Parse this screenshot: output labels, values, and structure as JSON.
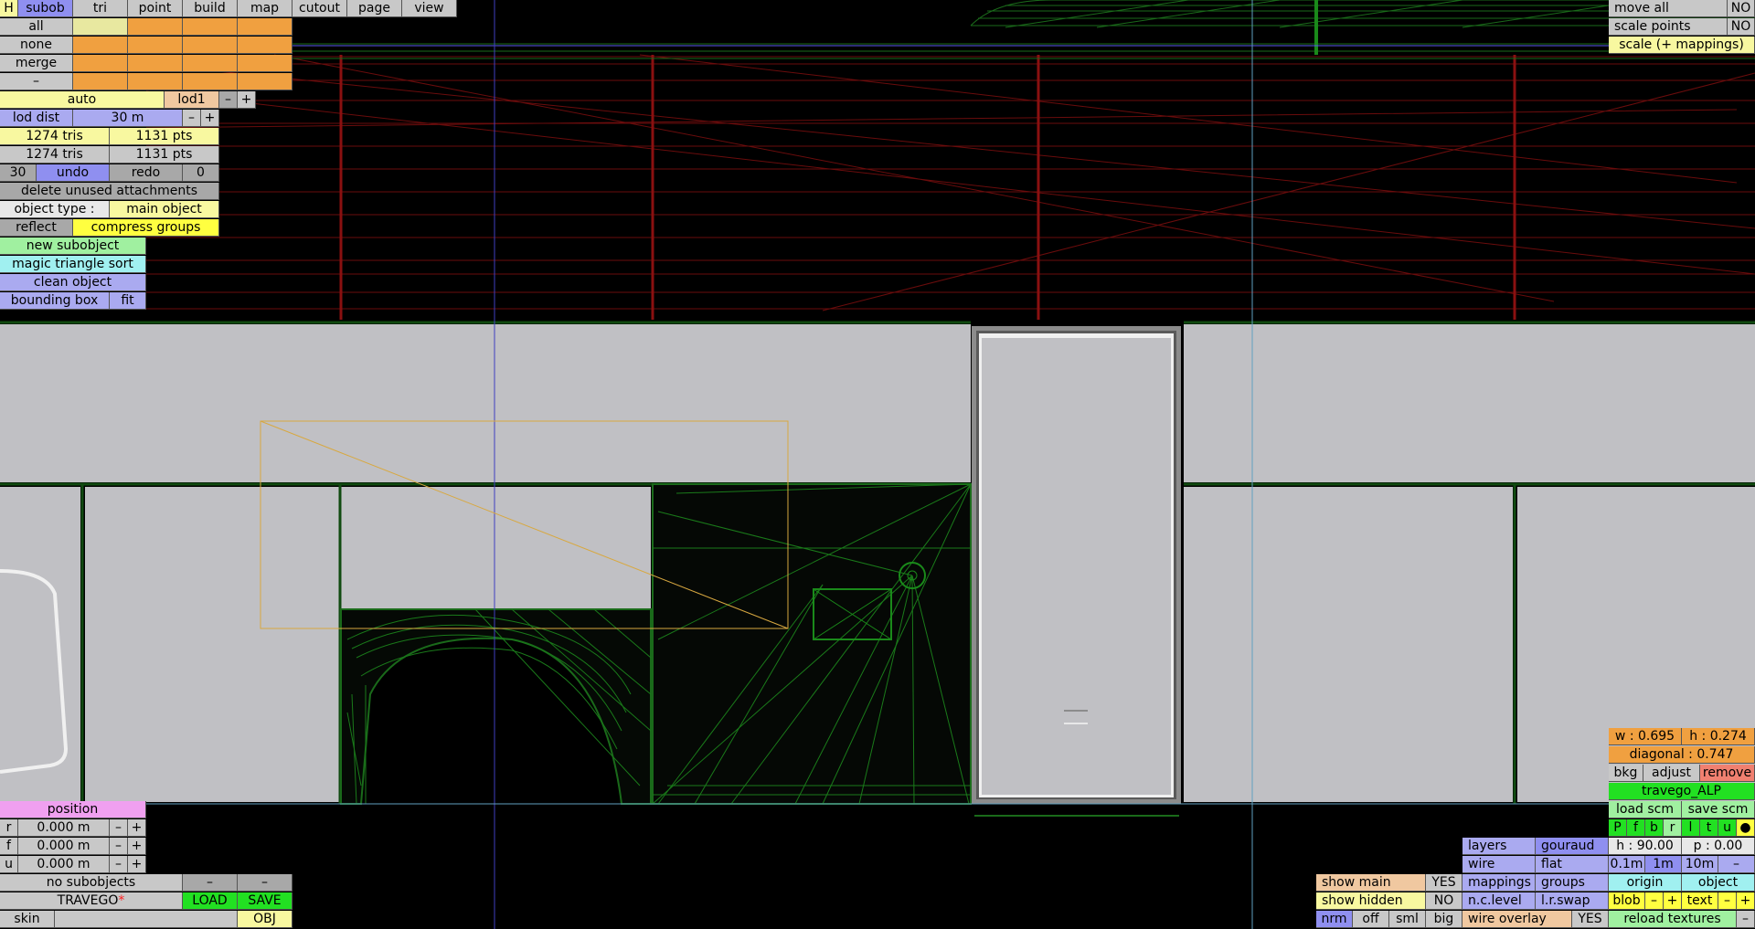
{
  "top_tabs": [
    "H",
    "subob",
    "tri",
    "point",
    "build",
    "map",
    "cutout",
    "page",
    "view"
  ],
  "select_rows": [
    "all",
    "none",
    "merge",
    "–"
  ],
  "lod": {
    "auto": "auto",
    "name": "lod1",
    "minus": "–",
    "plus": "+"
  },
  "lod_dist": {
    "label": "lod dist",
    "value": "30 m",
    "minus": "–",
    "plus": "+"
  },
  "stats": [
    {
      "tris": "1274 tris",
      "pts": "1131 pts"
    },
    {
      "tris": "1274 tris",
      "pts": "1131 pts"
    }
  ],
  "history": {
    "count": "30",
    "undo": "undo",
    "redo": "redo",
    "redo_count": "0"
  },
  "delete_unused": "delete unused attachments",
  "object_type": {
    "label": "object type :",
    "value": "main object"
  },
  "reflect": "reflect",
  "compress_groups": "compress groups",
  "new_subobject": "new subobject",
  "magic_sort": "magic triangle sort",
  "clean_object": "clean object",
  "bounding_box": "bounding box",
  "fit": "fit",
  "position": {
    "title": "position",
    "rows": [
      {
        "axis": "r",
        "value": "0.000 m"
      },
      {
        "axis": "f",
        "value": "0.000 m"
      },
      {
        "axis": "u",
        "value": "0.000 m"
      }
    ],
    "minus": "–",
    "plus": "+"
  },
  "bottom_left": {
    "no_subobjects": "no subobjects",
    "dash": "–",
    "file_name": "TRAVEGO",
    "modified_mark": "*",
    "load": "LOAD",
    "save": "SAVE",
    "skin": "skin",
    "obj": "OBJ"
  },
  "top_right": {
    "move_all": "move all",
    "move_all_value": "NO",
    "scale_points": "scale points",
    "scale_points_value": "NO",
    "scale_mappings": "scale (+ mappings)"
  },
  "image_panel": {
    "w": "w : 0.695",
    "h": "h : 0.274",
    "diagonal": "diagonal : 0.747",
    "bkg": "bkg",
    "adjust": "adjust",
    "remove": "remove",
    "image_name": "travego_ALP",
    "load_scm": "load scm",
    "save_scm": "save scm",
    "views": [
      "P",
      "f",
      "b",
      "r",
      "l",
      "t",
      "u",
      "●"
    ],
    "h_angle": "h : 90.00",
    "p_angle": "p : 0.00",
    "steps": [
      "0.1m",
      "1m",
      "10m",
      "–"
    ],
    "origin": "origin",
    "object": "object",
    "blob": "blob",
    "text": "text",
    "minus": "–",
    "plus": "+",
    "reload_textures": "reload textures"
  },
  "display_panel": {
    "layers": "layers",
    "gouraud": "gouraud",
    "wire": "wire",
    "flat": "flat",
    "mappings": "mappings",
    "groups": "groups",
    "nc_level": "n.c.level",
    "lr_swap": "l.r.swap",
    "show_main": "show main",
    "show_main_value": "YES",
    "show_hidden": "show hidden",
    "show_hidden_value": "NO",
    "nrm": "nrm",
    "off": "off",
    "sml": "sml",
    "big": "big",
    "wire_overlay": "wire overlay",
    "wire_overlay_value": "YES"
  },
  "colors": {
    "accent_blue": "#8f8ff0",
    "orange": "#f0a040",
    "yellow": "#f8f8a0",
    "green": "#22e022",
    "viewport_gray": "#c0c0c4",
    "wire_green": "#1a8a1a",
    "wire_red": "#8a1010"
  }
}
